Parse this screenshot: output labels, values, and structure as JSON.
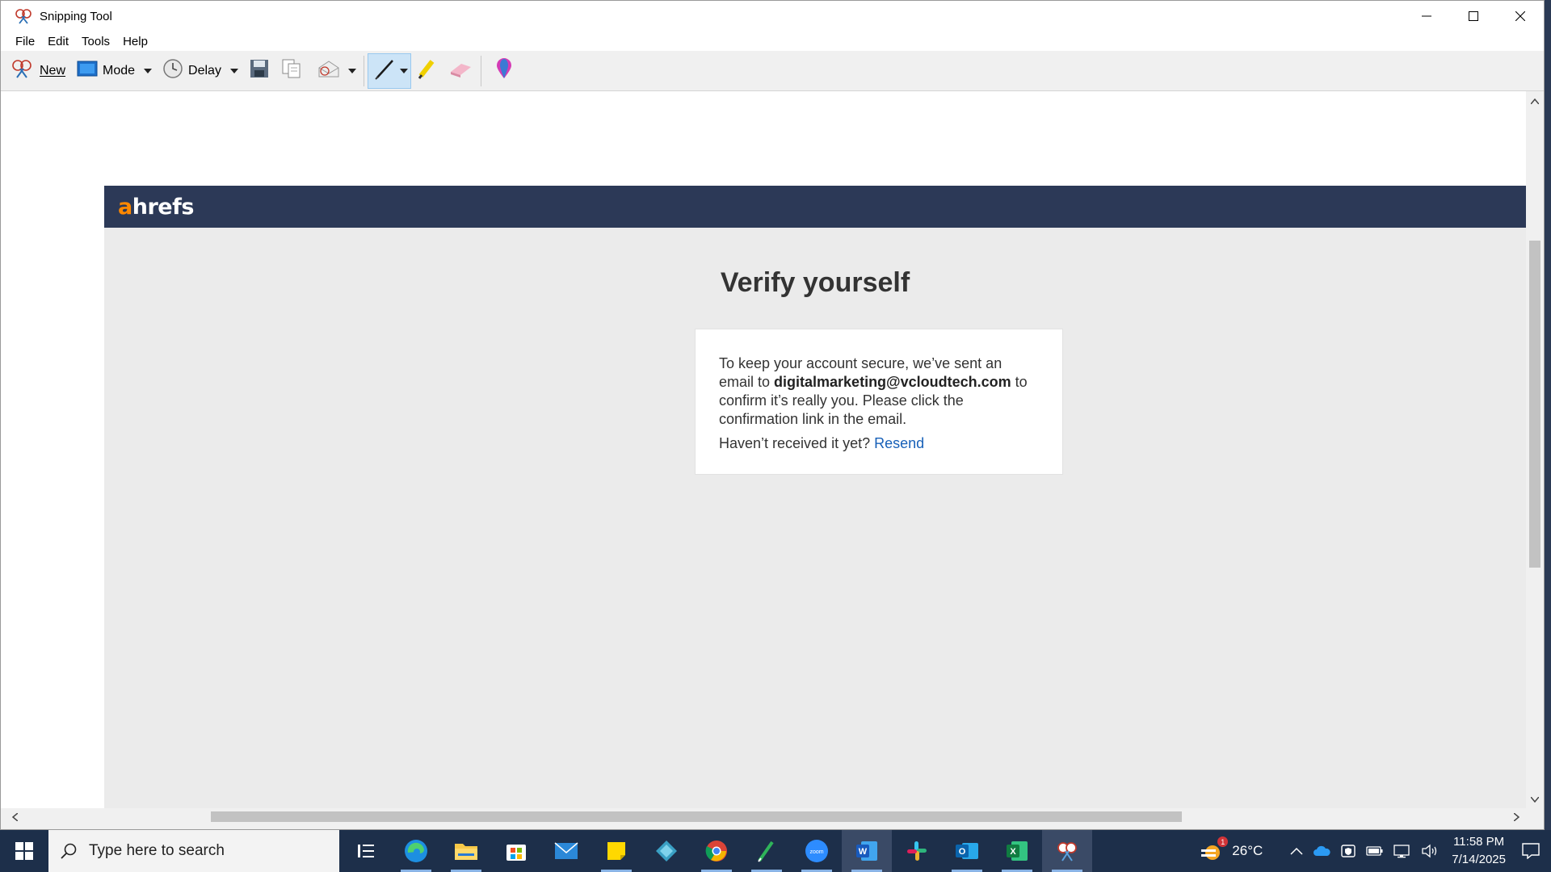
{
  "window": {
    "title": "Snipping Tool",
    "menu": [
      "File",
      "Edit",
      "Tools",
      "Help"
    ],
    "toolbar": {
      "new_label": "New",
      "mode_label": "Mode",
      "delay_label": "Delay"
    }
  },
  "page": {
    "logo_a": "a",
    "logo_rest": "hrefs",
    "heading": "Verify yourself",
    "message_part1": "To keep your account secure, we’ve sent an email to ",
    "email": "digitalmarketing@vcloudtech.com",
    "message_part2": " to confirm it’s really you. Please click the confirmation link in the email.",
    "resend_prompt": "Haven’t received it yet? ",
    "resend_link": "Resend"
  },
  "taskbar": {
    "search_placeholder": "Type here to search",
    "weather_temp": "26°C",
    "weather_badge": "1",
    "time": "11:58 PM",
    "date": "7/14/2025"
  },
  "colors": {
    "ahrefs_navy": "#2c3957",
    "ahrefs_orange": "#ff8800",
    "link_blue": "#1760b8",
    "pen_highlight": "#cce4f7"
  }
}
